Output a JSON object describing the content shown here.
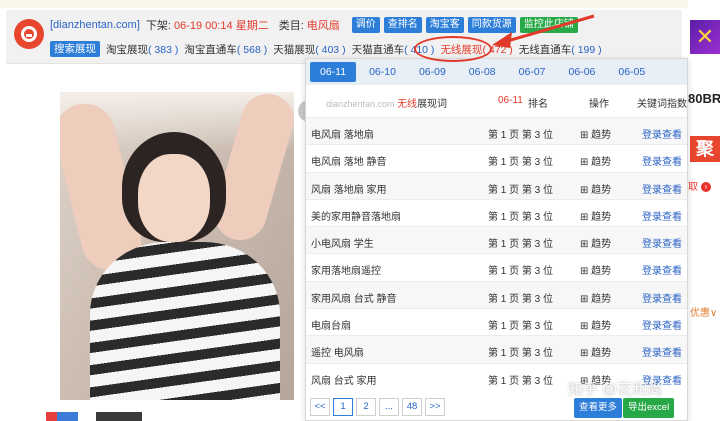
{
  "header": {
    "site": "[dianzhentan.com]",
    "offline_label": "下架:",
    "offline_time": "06-19 00:14 星期二",
    "category_label": "类目:",
    "category_value": "电风扇",
    "buttons": [
      {
        "label": "调价",
        "color": "#2d7ed8"
      },
      {
        "label": "查排名",
        "color": "#2d7ed8"
      },
      {
        "label": "淘宝客",
        "color": "#2d7ed8"
      },
      {
        "label": "同款货源",
        "color": "#2d7ed8"
      },
      {
        "label": "监控此店铺",
        "color": "#26a946"
      }
    ]
  },
  "search_bar": {
    "label": "搜索展现",
    "items": [
      {
        "name": "淘宝展现",
        "count": "( 383 )"
      },
      {
        "name": "淘宝直通车",
        "count": "( 568 )"
      },
      {
        "name": "天猫展现",
        "count": "( 403 )"
      },
      {
        "name": "天猫直通车",
        "count": "( 410 )"
      },
      {
        "name": "无线展现",
        "count": "( 472 )",
        "active": true
      },
      {
        "name": "无线直通车",
        "count": "( 199 )"
      }
    ]
  },
  "popup": {
    "date_tabs": [
      "06-11",
      "06-10",
      "06-09",
      "06-08",
      "06-07",
      "06-06",
      "06-05"
    ],
    "active_tab": "06-11",
    "header": {
      "watermark": "dianzhentan.com",
      "wireless": "无线",
      "keyword_col": "展现词",
      "date": "06-11",
      "rank": "排名",
      "op": "操作",
      "index": "关键词指数"
    },
    "rows": [
      {
        "keyword": "电风扇 落地扇",
        "rank": "第 1 页 第 3 位",
        "trend": "⊞ 趋势",
        "login": "登录查看"
      },
      {
        "keyword": "电风扇 落地 静音",
        "rank": "第 1 页 第 3 位",
        "trend": "⊞ 趋势",
        "login": "登录查看"
      },
      {
        "keyword": "风扇 落地扇 家用",
        "rank": "第 1 页 第 3 位",
        "trend": "⊞ 趋势",
        "login": "登录查看"
      },
      {
        "keyword": "美的家用静音落地扇",
        "rank": "第 1 页 第 3 位",
        "trend": "⊞ 趋势",
        "login": "登录查看"
      },
      {
        "keyword": "小电风扇 学生",
        "rank": "第 1 页 第 3 位",
        "trend": "⊞ 趋势",
        "login": "登录查看"
      },
      {
        "keyword": "家用落地扇遥控",
        "rank": "第 1 页 第 3 位",
        "trend": "⊞ 趋势",
        "login": "登录查看"
      },
      {
        "keyword": "家用风扇 台式 静音",
        "rank": "第 1 页 第 3 位",
        "trend": "⊞ 趋势",
        "login": "登录查看"
      },
      {
        "keyword": "电扇台扇",
        "rank": "第 1 页 第 3 位",
        "trend": "⊞ 趋势",
        "login": "登录查看"
      },
      {
        "keyword": "遥控 电风扇",
        "rank": "第 1 页 第 3 位",
        "trend": "⊞ 趋势",
        "login": "登录查看"
      },
      {
        "keyword": "风扇 台式 家用",
        "rank": "第 1 页 第 3 位",
        "trend": "⊞ 趋势",
        "login": "登录查看"
      }
    ],
    "pager": [
      "<<",
      "1",
      "2",
      "...",
      "48",
      ">>"
    ],
    "more_button": "查看更多",
    "excel_button": "导出excel"
  },
  "right_fragments": {
    "sale": "80BR",
    "ju": "聚",
    "ju2": "取",
    "youhui": "优惠∨"
  },
  "watermark": "知乎 @花和尚"
}
